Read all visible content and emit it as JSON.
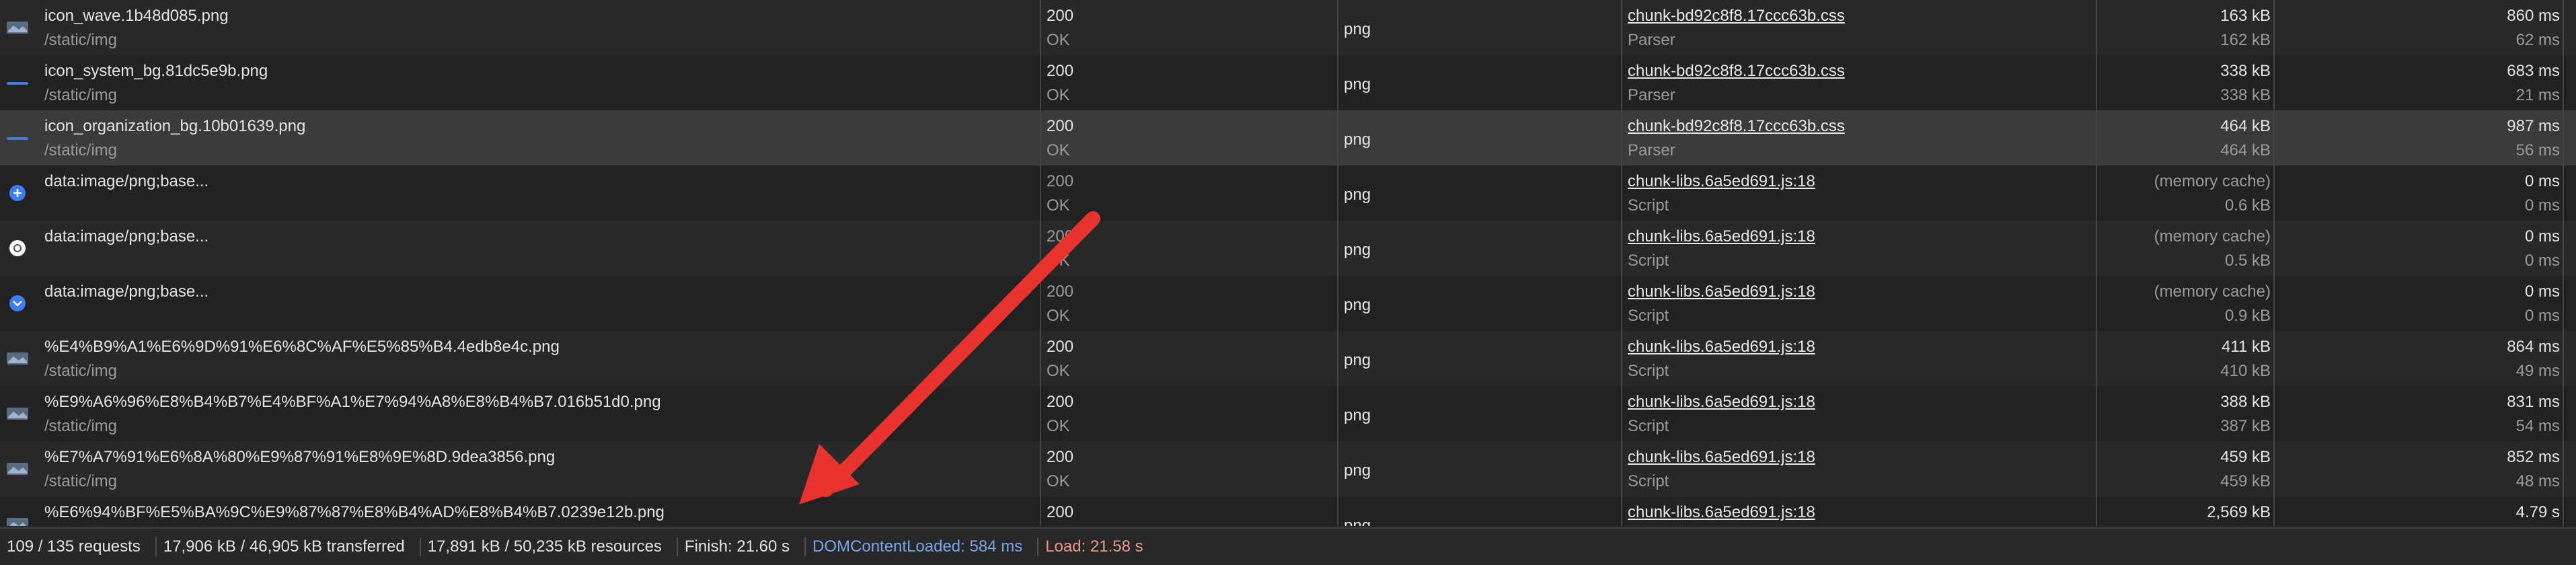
{
  "rows": [
    {
      "name": "icon_wave.1b48d085.png",
      "path": "/static/img",
      "status": "200",
      "status_text": "OK",
      "type": "png",
      "initiator": "chunk-bd92c8f8.17ccc63b.css",
      "initiator_type": "Parser",
      "size": "163 kB",
      "size_resource": "162 kB",
      "time": "860 ms",
      "time_sub": "62 ms",
      "icon": "image-thumbnail-icon",
      "cached": false
    },
    {
      "name": "icon_system_bg.81dc5e9b.png",
      "path": "/static/img",
      "status": "200",
      "status_text": "OK",
      "type": "png",
      "initiator": "chunk-bd92c8f8.17ccc63b.css",
      "initiator_type": "Parser",
      "size": "338 kB",
      "size_resource": "338 kB",
      "time": "683 ms",
      "time_sub": "21 ms",
      "icon": "blue-line-thumbnail-icon",
      "cached": false
    },
    {
      "name": "icon_organization_bg.10b01639.png",
      "path": "/static/img",
      "status": "200",
      "status_text": "OK",
      "type": "png",
      "initiator": "chunk-bd92c8f8.17ccc63b.css",
      "initiator_type": "Parser",
      "size": "464 kB",
      "size_resource": "464 kB",
      "time": "987 ms",
      "time_sub": "56 ms",
      "icon": "blue-line-thumbnail-icon",
      "cached": false,
      "selected": true
    },
    {
      "name": "data:image/png;base...",
      "path": "",
      "status": "200",
      "status_text": "OK",
      "type": "png",
      "initiator": "chunk-libs.6a5ed691.js:18",
      "initiator_type": "Script",
      "size": "(memory cache)",
      "size_resource": "0.6 kB",
      "time": "0 ms",
      "time_sub": "0 ms",
      "icon": "blue-plus-circle-icon",
      "cached": true
    },
    {
      "name": "data:image/png;base...",
      "path": "",
      "status": "200",
      "status_text": "OK",
      "type": "png",
      "initiator": "chunk-libs.6a5ed691.js:18",
      "initiator_type": "Script",
      "size": "(memory cache)",
      "size_resource": "0.5 kB",
      "time": "0 ms",
      "time_sub": "0 ms",
      "icon": "white-circle-icon",
      "cached": true
    },
    {
      "name": "data:image/png;base...",
      "path": "",
      "status": "200",
      "status_text": "OK",
      "type": "png",
      "initiator": "chunk-libs.6a5ed691.js:18",
      "initiator_type": "Script",
      "size": "(memory cache)",
      "size_resource": "0.9 kB",
      "time": "0 ms",
      "time_sub": "0 ms",
      "icon": "blue-chevron-circle-icon",
      "cached": true
    },
    {
      "name": "%E4%B9%A1%E6%9D%91%E6%8C%AF%E5%85%B4.4edb8e4c.png",
      "path": "/static/img",
      "status": "200",
      "status_text": "OK",
      "type": "png",
      "initiator": "chunk-libs.6a5ed691.js:18",
      "initiator_type": "Script",
      "size": "411 kB",
      "size_resource": "410 kB",
      "time": "864 ms",
      "time_sub": "49 ms",
      "icon": "image-thumbnail-icon",
      "cached": false
    },
    {
      "name": "%E9%A6%96%E8%B4%B7%E4%BF%A1%E7%94%A8%E8%B4%B7.016b51d0.png",
      "path": "/static/img",
      "status": "200",
      "status_text": "OK",
      "type": "png",
      "initiator": "chunk-libs.6a5ed691.js:18",
      "initiator_type": "Script",
      "size": "388 kB",
      "size_resource": "387 kB",
      "time": "831 ms",
      "time_sub": "54 ms",
      "icon": "image-thumbnail-icon",
      "cached": false
    },
    {
      "name": "%E7%A7%91%E6%8A%80%E9%87%91%E8%9E%8D.9dea3856.png",
      "path": "/static/img",
      "status": "200",
      "status_text": "OK",
      "type": "png",
      "initiator": "chunk-libs.6a5ed691.js:18",
      "initiator_type": "Script",
      "size": "459 kB",
      "size_resource": "459 kB",
      "time": "852 ms",
      "time_sub": "48 ms",
      "icon": "image-thumbnail-icon",
      "cached": false
    },
    {
      "name": "%E6%94%BF%E5%BA%9C%E9%87%87%E8%B4%AD%E8%B4%B7.0239e12b.png",
      "path": "",
      "status": "200",
      "status_text": "",
      "type": "png",
      "initiator": "chunk-libs.6a5ed691.js:18",
      "initiator_type": "",
      "size": "2,569 kB",
      "size_resource": "",
      "time": "4.79 s",
      "time_sub": "",
      "icon": "image-thumbnail-icon",
      "cached": false
    }
  ],
  "statusbar": {
    "requests": "109 / 135 requests",
    "transferred": "17,906 kB / 46,905 kB transferred",
    "resources": "17,891 kB / 50,235 kB resources",
    "finish": "Finish: 21.60 s",
    "dom_content_loaded": "DOMContentLoaded: 584 ms",
    "load": "Load: 21.58 s"
  },
  "colors": {
    "dom_content_loaded": "#7aa5e8",
    "load": "#e8978a",
    "arrow": "#e8322d"
  }
}
